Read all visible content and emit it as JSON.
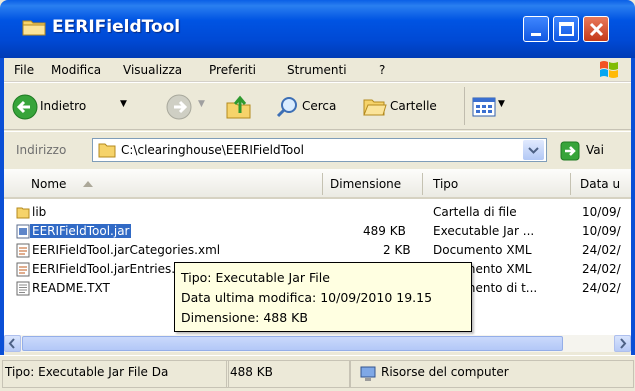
{
  "window": {
    "title": "EERIFieldTool"
  },
  "menu": [
    "File",
    "Modifica",
    "Visualizza",
    "Preferiti",
    "Strumenti",
    "?"
  ],
  "toolbar": {
    "back_label": "Indietro",
    "search_label": "Cerca",
    "folders_label": "Cartelle"
  },
  "address": {
    "label": "Indirizzo",
    "value": "C:\\clearinghouse\\EERIFieldTool",
    "go_label": "Vai"
  },
  "columns": {
    "name": "Nome",
    "size": "Dimensione",
    "type": "Tipo",
    "date": "Data u"
  },
  "files": [
    {
      "name": "lib",
      "size": "",
      "type": "Cartella di file",
      "date": "10/09/",
      "icon": "folder-icon"
    },
    {
      "name": "EERIFieldTool.jar",
      "size": "489 KB",
      "type": "Executable Jar ...",
      "date": "10/09/",
      "icon": "jar-file-icon"
    },
    {
      "name": "EERIFieldTool.jarCategories.xml",
      "size": "2 KB",
      "type": "Documento XML",
      "date": "24/02/",
      "icon": "xml-file-icon"
    },
    {
      "name": "EERIFieldTool.jarEntries.xml",
      "size": "",
      "type": "Documento XML",
      "date": "24/02/",
      "icon": "xml-file-icon"
    },
    {
      "name": "README.TXT",
      "size": "",
      "type": "Documento di t...",
      "date": "24/02/",
      "icon": "text-file-icon"
    }
  ],
  "tooltip": {
    "type_line": "Tipo: Executable Jar File",
    "date_line": "Data ultima modifica: 10/09/2010 19.15",
    "size_line": "Dimensione: 488 KB"
  },
  "status": {
    "left_text": "Tipo: Executable Jar File Da",
    "size_text": "488 KB",
    "location_text": "Risorse del computer"
  },
  "colors": {
    "titlebar": "#0054e3",
    "selection": "#316ac5",
    "tooltip_bg": "#ffffe1"
  }
}
